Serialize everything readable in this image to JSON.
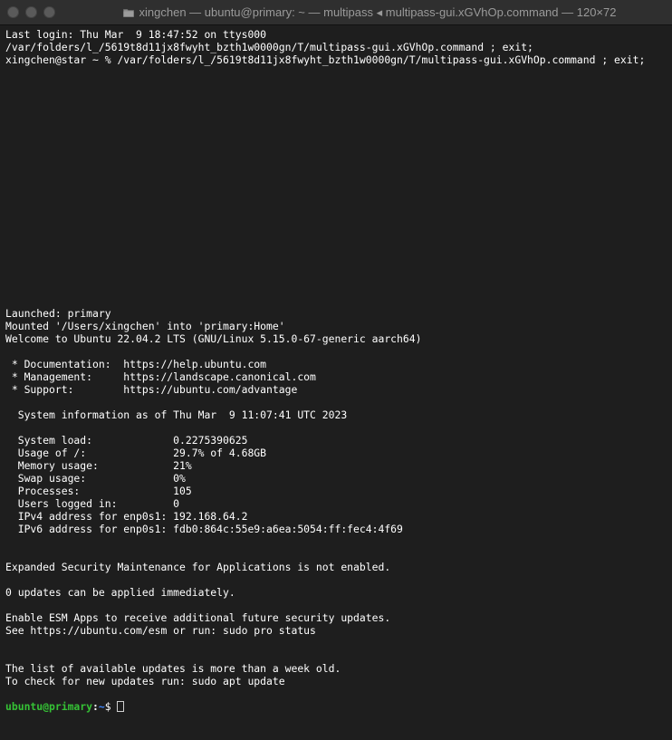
{
  "window": {
    "title": "xingchen — ubuntu@primary: ~ — multipass ◂ multipass-gui.xGVhOp.command — 120×72",
    "colors": {
      "background": "#1e1e1e",
      "titlebar": "#2f2f2f",
      "text": "#ffffff",
      "prompt_user": "#35c235",
      "prompt_path": "#3f86ff"
    },
    "icons": [
      "close-button-icon",
      "minimize-button-icon",
      "zoom-button-icon",
      "folder-icon"
    ]
  },
  "terminal": {
    "lines": [
      "Last login: Thu Mar  9 18:47:52 on ttys000",
      "/var/folders/l_/5619t8d11jx8fwyht_bzth1w0000gn/T/multipass-gui.xGVhOp.command ; exit;",
      "xingchen@star ~ % /var/folders/l_/5619t8d11jx8fwyht_bzth1w0000gn/T/multipass-gui.xGVhOp.command ; exit;",
      "",
      "",
      "",
      "",
      "",
      "",
      "",
      "",
      "",
      "",
      "",
      "",
      "",
      "",
      "",
      "",
      "",
      "",
      "",
      "Launched: primary",
      "Mounted '/Users/xingchen' into 'primary:Home'",
      "Welcome to Ubuntu 22.04.2 LTS (GNU/Linux 5.15.0-67-generic aarch64)",
      "",
      " * Documentation:  https://help.ubuntu.com",
      " * Management:     https://landscape.canonical.com",
      " * Support:        https://ubuntu.com/advantage",
      "",
      "  System information as of Thu Mar  9 11:07:41 UTC 2023",
      "",
      "  System load:             0.2275390625",
      "  Usage of /:              29.7% of 4.68GB",
      "  Memory usage:            21%",
      "  Swap usage:              0%",
      "  Processes:               105",
      "  Users logged in:         0",
      "  IPv4 address for enp0s1: 192.168.64.2",
      "  IPv6 address for enp0s1: fdb0:864c:55e9:a6ea:5054:ff:fec4:4f69",
      "",
      "",
      "Expanded Security Maintenance for Applications is not enabled.",
      "",
      "0 updates can be applied immediately.",
      "",
      "Enable ESM Apps to receive additional future security updates.",
      "See https://ubuntu.com/esm or run: sudo pro status",
      "",
      "",
      "The list of available updates is more than a week old.",
      "To check for new updates run: sudo apt update",
      ""
    ],
    "prompt": {
      "user_host": "ubuntu@primary",
      "separator": ":",
      "path": "~",
      "symbol": "$"
    }
  }
}
